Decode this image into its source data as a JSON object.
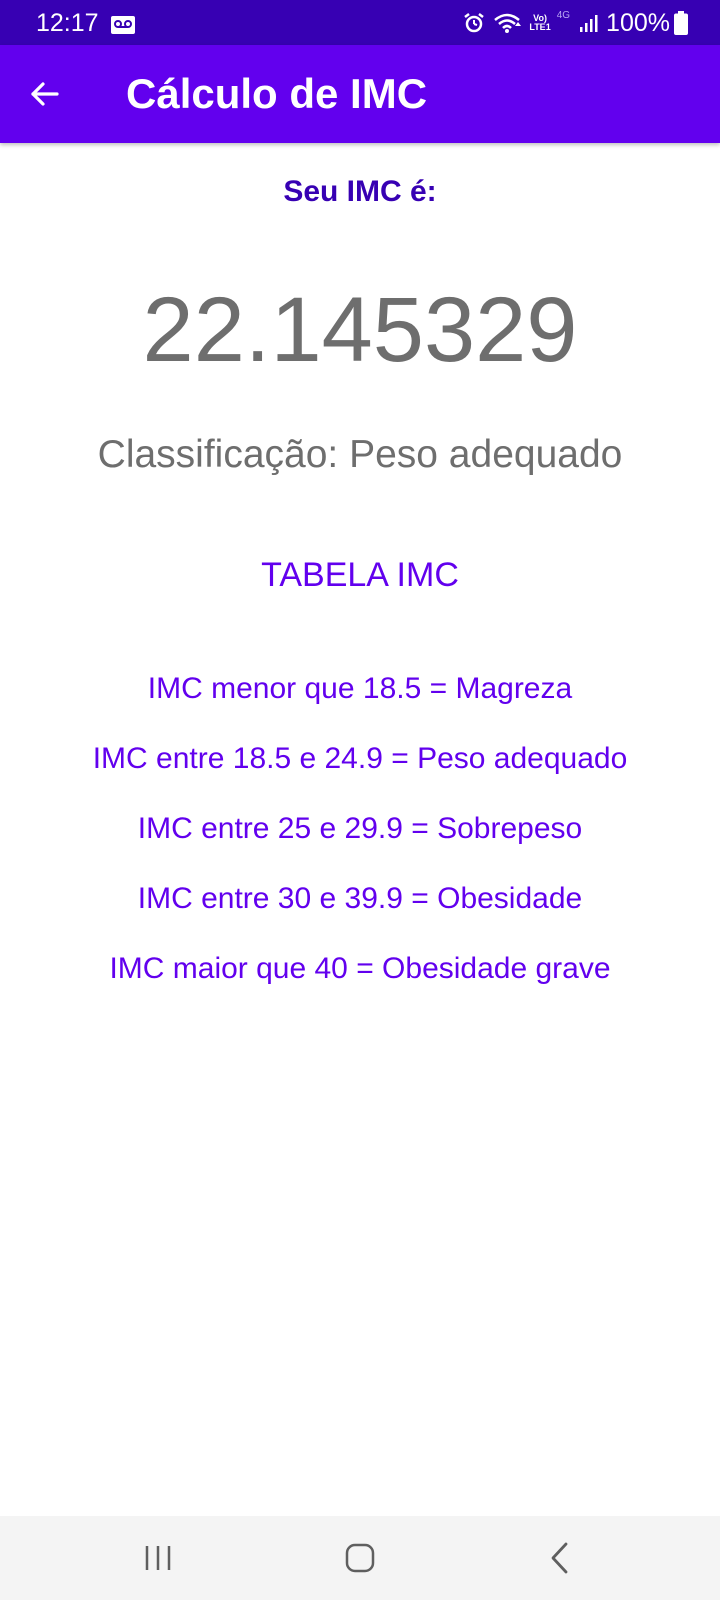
{
  "status_bar": {
    "time": "12:17",
    "battery_percent": "100%",
    "network_label": "4G",
    "volte_top": "Vo)",
    "volte_bottom": "LTE1",
    "icons": [
      "voicemail-icon",
      "alarm-icon",
      "wifi-icon",
      "volte-icon",
      "signal-icon",
      "battery-icon"
    ]
  },
  "app_bar": {
    "title": "Cálculo de IMC",
    "back_icon": "arrow-back-icon",
    "color": "#6200ee"
  },
  "result": {
    "label": "Seu IMC é:",
    "value": "22.145329",
    "classification": "Classificação: Peso adequado"
  },
  "table": {
    "title": "TABELA IMC",
    "rows": [
      "IMC menor que 18.5 = Magreza",
      "IMC entre 18.5 e 24.9 = Peso adequado",
      "IMC entre 25 e 29.9 = Sobrepeso",
      "IMC entre 30 e 39.9 = Obesidade",
      "IMC maior que 40 = Obesidade grave"
    ]
  },
  "nav_bar": {
    "icons": [
      "recent-apps-icon",
      "home-icon",
      "back-icon"
    ]
  },
  "colors": {
    "status_bar": "#3700b3",
    "primary": "#6200ee",
    "label_dark": "#3700b3",
    "value_gray": "#6e6e6e"
  }
}
